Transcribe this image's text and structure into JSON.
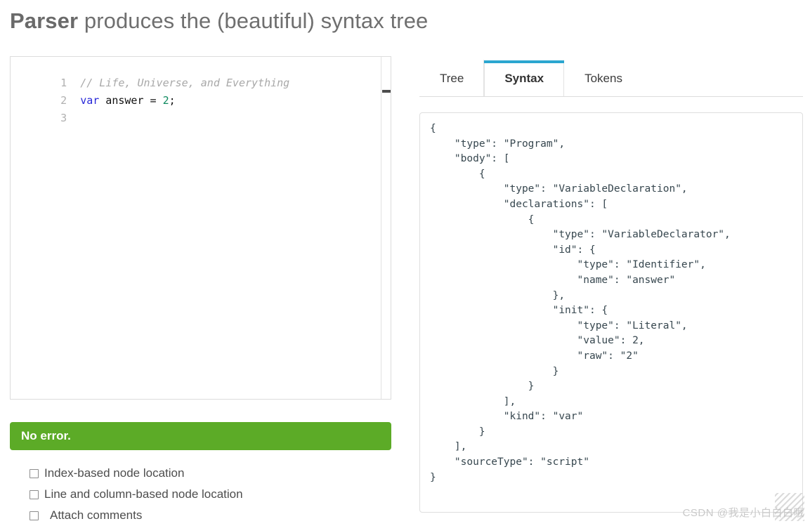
{
  "title": {
    "strong": "Parser",
    "rest": " produces the (beautiful) syntax tree"
  },
  "editor": {
    "lines": [
      {
        "number": "1",
        "text": "// Life, Universe, and Everything",
        "kind": "comment",
        "active": false
      },
      {
        "number": "2",
        "text": "var answer = 2;",
        "kind": "code",
        "active": false
      },
      {
        "number": "3",
        "text": "",
        "kind": "empty",
        "active": true
      }
    ],
    "line1_comment": "// Life, Universe, and Everything",
    "line2_keyword": "var",
    "line2_identifier": " answer = ",
    "line2_number": "2",
    "line2_terminator": ";"
  },
  "status": {
    "label": "No error.",
    "color": "#5cab27"
  },
  "options": [
    {
      "label": "Index-based node location",
      "checked": false
    },
    {
      "label": "Line and column-based node location",
      "checked": false
    },
    {
      "label": "Attach comments",
      "checked": false
    }
  ],
  "tabs": [
    {
      "label": "Tree",
      "active": false
    },
    {
      "label": "Syntax",
      "active": true
    },
    {
      "label": "Tokens",
      "active": false
    }
  ],
  "accent_color": "#2ba6d0",
  "ast": {
    "text": "{\n    \"type\": \"Program\",\n    \"body\": [\n        {\n            \"type\": \"VariableDeclaration\",\n            \"declarations\": [\n                {\n                    \"type\": \"VariableDeclarator\",\n                    \"id\": {\n                        \"type\": \"Identifier\",\n                        \"name\": \"answer\"\n                    },\n                    \"init\": {\n                        \"type\": \"Literal\",\n                        \"value\": 2,\n                        \"raw\": \"2\"\n                    }\n                }\n            ],\n            \"kind\": \"var\"\n        }\n    ],\n    \"sourceType\": \"script\"\n}"
  },
  "watermark": {
    "text": "CSDN @我是小白白白哦"
  }
}
